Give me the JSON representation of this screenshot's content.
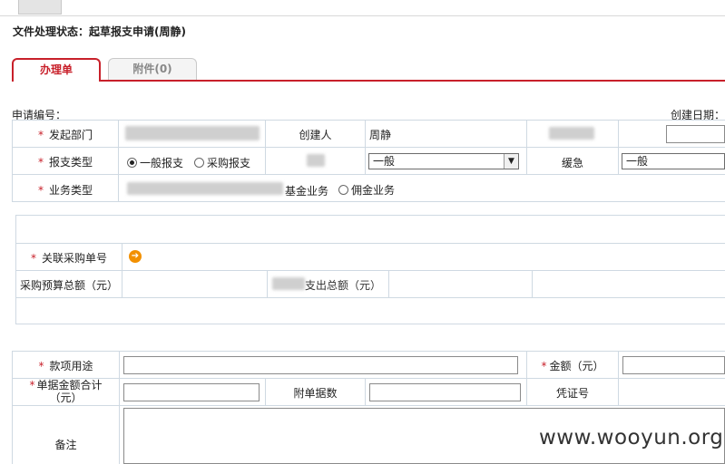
{
  "status": {
    "text": "文件处理状态：起草报支申请(周静)"
  },
  "tabs": {
    "active": "办理单",
    "attachment": "附件(0)"
  },
  "header": {
    "app_no_label": "申请编号：",
    "created_date_label": "创建日期："
  },
  "form": {
    "dept_label": "发起部门",
    "creator_label": "创建人",
    "creator_value": "周静",
    "report_type_label": "报支类型",
    "report_type_opt1": "一般报支",
    "report_type_opt2": "采购报支",
    "select_value_1": "一般",
    "urgency_label": "缓急",
    "urgency_value": "一般",
    "business_type_label": "业务类型",
    "fund_business": "基金业务",
    "commission_business": "佣金业务",
    "linked_po_label": "关联采购单号",
    "budget_total_label": "采购预算总额（元）",
    "expense_total_label": "支出总额（元）",
    "purpose_label": "款项用途",
    "amount_label": "金额（元）",
    "doc_total_label_1": "单据金额合计",
    "doc_total_label_2": "（元）",
    "attachments_label": "附单据数",
    "voucher_label": "凭证号",
    "remark_label": "备注"
  },
  "watermark": "www.wooyun.org",
  "colors": {
    "accent": "#c8202a",
    "border": "#cfd9e2",
    "icon": "#f29000"
  }
}
